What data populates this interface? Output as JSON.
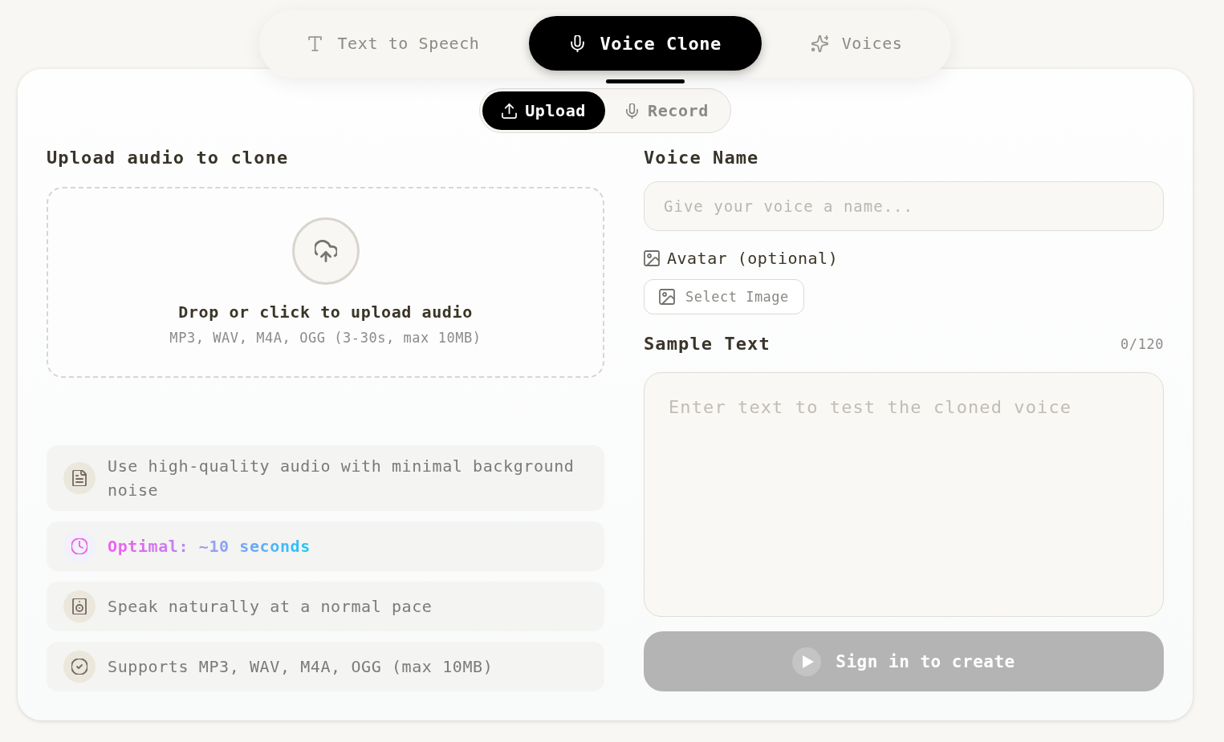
{
  "tabs": [
    {
      "label": "Text to Speech",
      "selected": false
    },
    {
      "label": "Voice Clone",
      "selected": true
    },
    {
      "label": "Voices",
      "selected": false
    }
  ],
  "source_toggle": [
    {
      "label": "Upload",
      "selected": true
    },
    {
      "label": "Record",
      "selected": false
    }
  ],
  "upload": {
    "title": "Upload audio to clone",
    "dropzone": {
      "title": "Drop or click to upload audio",
      "hint": "MP3, WAV, M4A, OGG (3-30s, max 10MB)"
    }
  },
  "tips": [
    {
      "kind": "plain",
      "text": "Use high-quality audio with minimal background noise"
    },
    {
      "kind": "highlight",
      "text": "Optimal: ~10 seconds"
    },
    {
      "kind": "plain",
      "text": "Speak naturally at a normal pace"
    },
    {
      "kind": "plain",
      "text": "Supports MP3, WAV, M4A, OGG (max 10MB)"
    }
  ],
  "voice_name": {
    "label": "Voice Name",
    "placeholder": "Give your voice a name..."
  },
  "avatar": {
    "label": "Avatar (optional)",
    "button": "Select Image"
  },
  "sample_text": {
    "label": "Sample Text",
    "counter": "0/120",
    "placeholder": "Enter text to test the cloned voice"
  },
  "submit": {
    "label": "Sign in to create",
    "disabled": true
  }
}
